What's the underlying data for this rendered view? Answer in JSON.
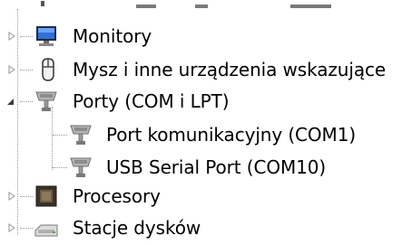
{
  "device_manager": {
    "items": [
      {
        "label": "Monitory",
        "icon": "monitor-icon",
        "expander": "collapsed"
      },
      {
        "label": "Mysz i inne urządzenia wskazujące",
        "icon": "mouse-icon",
        "expander": "collapsed"
      },
      {
        "label": "Porty (COM i LPT)",
        "icon": "port-icon",
        "expander": "expanded",
        "children": [
          {
            "label": "Port komunikacyjny (COM1)",
            "icon": "port-icon"
          },
          {
            "label": "USB Serial Port (COM10)",
            "icon": "port-icon"
          }
        ]
      },
      {
        "label": "Procesory",
        "icon": "processor-icon",
        "expander": "collapsed"
      },
      {
        "label": "Stacje dysków",
        "icon": "disk-drive-icon",
        "expander": "collapsed"
      }
    ]
  },
  "colors": {
    "dotted_line": "#9a9a9a",
    "expander_collapsed": "#a6a6a6",
    "expander_expanded": "#3c3c3c",
    "monitor_screen": "#2f6fd6",
    "port_gray": "#8c8c8c",
    "processor_dark": "#4a3f2f"
  }
}
